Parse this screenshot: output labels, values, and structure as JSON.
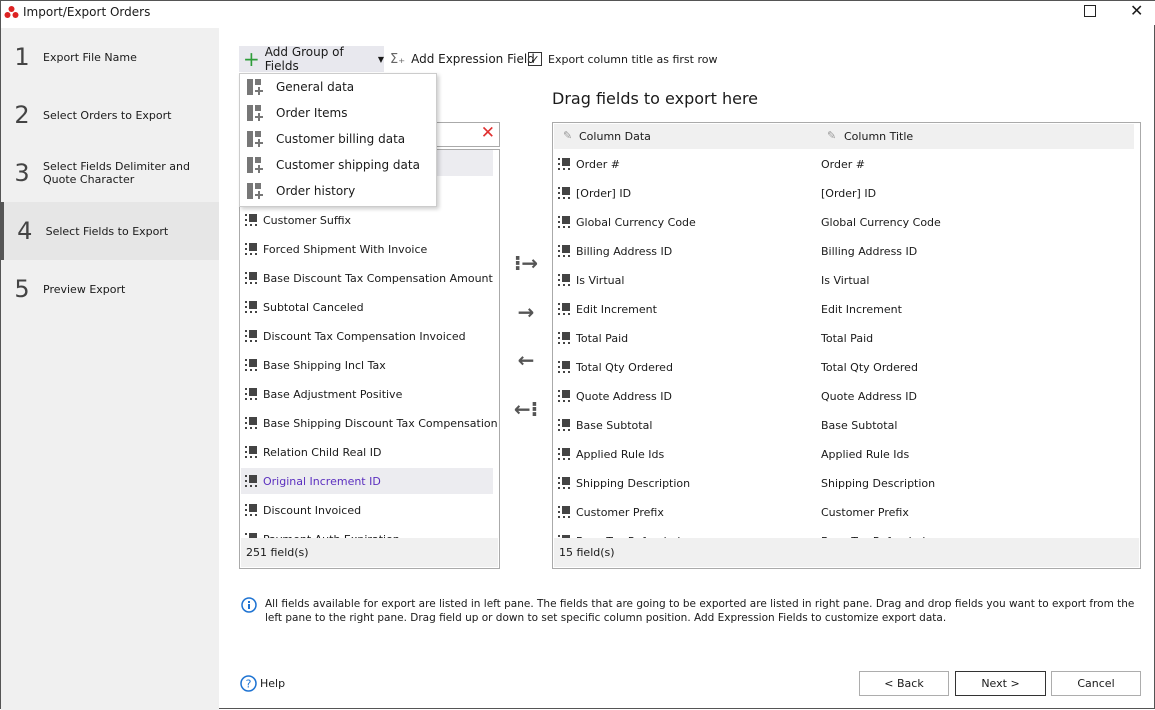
{
  "window": {
    "title": "Import/Export Orders"
  },
  "steps": [
    {
      "num": "1",
      "label": "Export File Name"
    },
    {
      "num": "2",
      "label": "Select Orders to Export"
    },
    {
      "num": "3",
      "label": "Select Fields Delimiter and Quote Character"
    },
    {
      "num": "4",
      "label": "Select Fields to Export",
      "selected": true
    },
    {
      "num": "5",
      "label": "Preview Export"
    }
  ],
  "toolbar": {
    "add_group": "Add Group of Fields",
    "add_expression": "Add Expression Field",
    "export_title_checkbox": "Export column title as first row",
    "export_title_checked": true
  },
  "group_menu": [
    "General data",
    "Order Items",
    "Customer billing data",
    "Customer shipping data",
    "Order history"
  ],
  "left_pane": {
    "search_value": "",
    "fields": [
      "Customer Suffix",
      "Forced Shipment With Invoice",
      "Base Discount Tax Compensation Amount",
      "Subtotal Canceled",
      "Discount Tax Compensation Invoiced",
      "Base Shipping Incl Tax",
      "Base Adjustment Positive",
      "Base Shipping Discount Tax Compensation A",
      "Relation Child Real ID",
      "Original Increment ID",
      "Discount Invoiced",
      "Payment Auth Expiration"
    ],
    "highlighted": "Original Increment ID",
    "count": "251 field(s)"
  },
  "right_pane": {
    "heading": "Drag fields to export here",
    "col_data": "Column Data",
    "col_title": "Column Title",
    "rows": [
      [
        "Order #",
        "Order #"
      ],
      [
        "[Order] ID",
        "[Order] ID"
      ],
      [
        "Global Currency Code",
        "Global Currency Code"
      ],
      [
        "Billing Address ID",
        "Billing Address ID"
      ],
      [
        "Is Virtual",
        "Is Virtual"
      ],
      [
        "Edit Increment",
        "Edit Increment"
      ],
      [
        "Total Paid",
        "Total Paid"
      ],
      [
        "Total Qty Ordered",
        "Total Qty Ordered"
      ],
      [
        "Quote Address ID",
        "Quote Address ID"
      ],
      [
        "Base Subtotal",
        "Base Subtotal"
      ],
      [
        "Applied Rule Ids",
        "Applied Rule Ids"
      ],
      [
        "Shipping Description",
        "Shipping Description"
      ],
      [
        "Customer Prefix",
        "Customer Prefix"
      ],
      [
        "Base Tax Refunded",
        "Base Tax Refunded"
      ]
    ],
    "count": "15 field(s)"
  },
  "info": "All fields available for export are listed in left pane. The fields that are going to be exported are listed in right pane. Drag and drop fields you want to export from the left pane to the right pane. Drag field up or down to set specific column position. Add Expression Fields to customize export data.",
  "footer": {
    "help": "Help",
    "back": "< Back",
    "next": "Next >",
    "cancel": "Cancel"
  },
  "colors": {
    "accent": "#2e7d32",
    "highlight_text": "#5b2fbf",
    "clear": "#e03030"
  }
}
